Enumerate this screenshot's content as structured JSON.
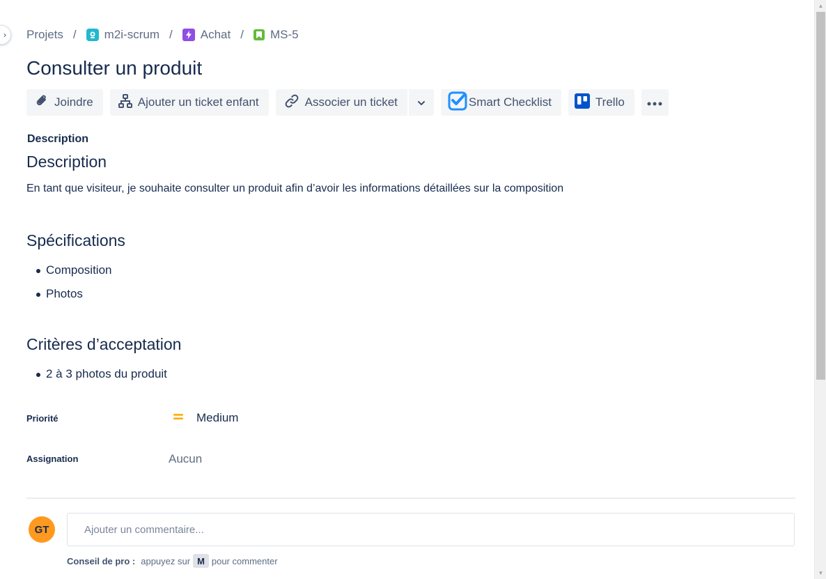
{
  "breadcrumbs": {
    "root": "Projets",
    "project": "m2i-scrum",
    "epic": "Achat",
    "issue": "MS-5",
    "separator": "/"
  },
  "issue": {
    "title": "Consulter un produit"
  },
  "toolbar": {
    "attach": "Joindre",
    "add_child": "Ajouter un ticket enfant",
    "link_issue": "Associer un ticket",
    "smart_checklist": "Smart Checklist",
    "trello": "Trello"
  },
  "description": {
    "section_label": "Description",
    "heading": "Description",
    "text": "En tant que visiteur, je souhaite consulter un produit afin d’avoir les informations détaillées sur la composition",
    "specs_heading": "Spécifications",
    "specs": [
      "Composition",
      "Photos"
    ],
    "criteria_heading": "Critères d’acceptation",
    "criteria": [
      "2 à 3 photos du produit"
    ]
  },
  "fields": {
    "priority_label": "Priorité",
    "priority_value": "Medium",
    "assignee_label": "Assignation",
    "assignee_value": "Aucun"
  },
  "comment": {
    "avatar_initials": "GT",
    "placeholder": "Ajouter un commentaire...",
    "protip_label": "Conseil de pro :",
    "protip_text_before": "appuyez sur",
    "protip_key": "M",
    "protip_text_after": "pour commenter"
  },
  "colors": {
    "avatar": "#ff991f",
    "priority_medium": "#ffab00",
    "project_icon": "#22b8cf",
    "epic_icon": "#904ee2",
    "story_icon": "#63ba3c",
    "smart_checklist_brand": "#1e90ff",
    "trello_brand": "#0052cc"
  },
  "icons": {
    "attach": "paperclip-icon",
    "add_child": "hierarchy-icon",
    "link": "link-icon",
    "dropdown": "chevron-down-icon",
    "more": "more-horizontal-icon"
  }
}
